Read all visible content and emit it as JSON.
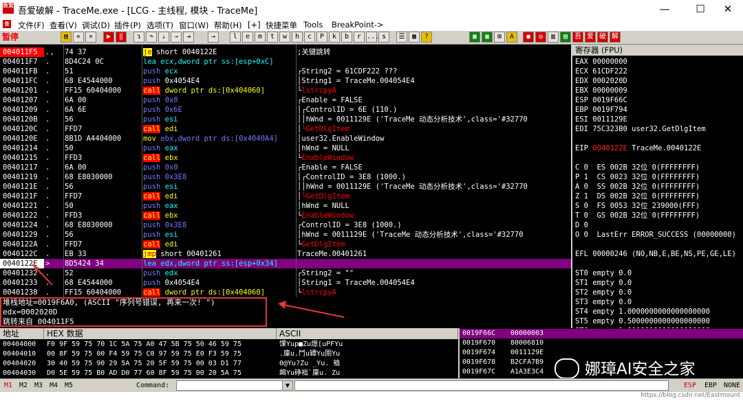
{
  "window": {
    "logo_text": "吾爱破解",
    "title": "吾爱破解 - TraceMe.exe - [LCG - 主线程, 模块 - TraceMe]",
    "min": "—",
    "max": "☐",
    "close": "✕"
  },
  "menu": [
    "文件(F)",
    "查看(V)",
    "调试(D)",
    "插件(P)",
    "选项(T)",
    "窗口(W)",
    "帮助(H)",
    "[+]",
    "快捷菜单",
    "Tools",
    "BreakPoint->"
  ],
  "toolbar": {
    "status": "暂停",
    "letters": [
      "l",
      "e",
      "m",
      "t",
      "w",
      "h",
      "c",
      "P",
      "k",
      "b",
      "r",
      "...",
      "s"
    ],
    "right_icons": [
      "吾",
      "爱",
      "破",
      "解"
    ]
  },
  "cpu": {
    "rows": [
      {
        "addr": "004011F5",
        "mark": "., ",
        "hex": "74 37",
        "mn": "je",
        "mncls": "op-jcc",
        "opd": "short 0040122E",
        "opdcls": "opd-w",
        "cmt": ";关键跳转",
        "cmtcls": "",
        "brk": "",
        "addrcls": "hl"
      },
      {
        "addr": "004011F7",
        "mark": ". ",
        "hex": "8D4C24 0C",
        "mn": "lea",
        "mncls": "op-lea",
        "opd": "ecx,dword ptr ss:[esp+0xC]",
        "opdcls": "opd-c",
        "cmt": "",
        "cmtcls": "",
        "brk": "",
        "addrcls": ""
      },
      {
        "addr": "004011FB",
        "mark": ". ",
        "hex": "51",
        "mn": "push",
        "mncls": "op-push",
        "opd": "ecx",
        "opdcls": "opd-c",
        "cmt": "String2 = 61CDF222 ???",
        "cmtcls": "",
        "brk": "┌",
        "addrcls": ""
      },
      {
        "addr": "004011FC",
        "mark": ". ",
        "hex": "68 E4544000",
        "mn": "push",
        "mncls": "op-push",
        "opd": "0x4054E4",
        "opdcls": "opd-w",
        "cmt": "String1 = TraceMe.004054E4",
        "cmtcls": "",
        "brk": "│",
        "addrcls": ""
      },
      {
        "addr": "00401201",
        "mark": ". ",
        "hex": "FF15 60404000",
        "mn": "call",
        "mncls": "op-call",
        "opd": "dword ptr ds:[0x404060]",
        "opdcls": "opd-y",
        "cmt": "lstrcpyA",
        "cmtcls": "cmt-red",
        "brk": "└",
        "addrcls": ""
      },
      {
        "addr": "00401207",
        "mark": ". ",
        "hex": "6A 00",
        "mn": "push",
        "mncls": "op-push",
        "opd": "0x0",
        "opdcls": "opd-b",
        "cmt": "Enable = FALSE",
        "cmtcls": "",
        "brk": "┌",
        "addrcls": ""
      },
      {
        "addr": "00401209",
        "mark": ". ",
        "hex": "6A 6E",
        "mn": "push",
        "mncls": "op-push",
        "opd": "0x6E",
        "opdcls": "opd-b",
        "cmt": "┌ControlID = 6E (110.)",
        "cmtcls": "",
        "brk": "│",
        "addrcls": ""
      },
      {
        "addr": "0040120B",
        "mark": ". ",
        "hex": "56",
        "mn": "push",
        "mncls": "op-push",
        "opd": "esi",
        "opdcls": "opd-c",
        "cmt": "│hWnd = 0011129E ('TraceMe 动态分析技术',class='#32770",
        "cmtcls": "",
        "brk": "│",
        "addrcls": ""
      },
      {
        "addr": "0040120C",
        "mark": ". ",
        "hex": "FFD7",
        "mn": "call",
        "mncls": "op-call",
        "opd": "edi",
        "opdcls": "opd-y",
        "cmt": "└GetDlgItem",
        "cmtcls": "cmt-red",
        "brk": "│",
        "addrcls": ""
      },
      {
        "addr": "0040120E",
        "mark": ". ",
        "hex": "8B1D A4404000",
        "mn": "mov",
        "mncls": "op-mov",
        "opd": "ebx,dword ptr ds:[0x4040A4]",
        "opdcls": "opd-b",
        "cmt": "user32.EnableWindow",
        "cmtcls": "",
        "brk": "│",
        "addrcls": ""
      },
      {
        "addr": "00401214",
        "mark": ". ",
        "hex": "50",
        "mn": "push",
        "mncls": "op-push",
        "opd": "eax",
        "opdcls": "opd-c",
        "cmt": "hWnd = NULL",
        "cmtcls": "",
        "brk": "│",
        "addrcls": ""
      },
      {
        "addr": "00401215",
        "mark": ". ",
        "hex": "FFD3",
        "mn": "call",
        "mncls": "op-call",
        "opd": "ebx",
        "opdcls": "opd-y",
        "cmt": "EnableWindow",
        "cmtcls": "cmt-red",
        "brk": "└",
        "addrcls": ""
      },
      {
        "addr": "00401217",
        "mark": ". ",
        "hex": "6A 00",
        "mn": "push",
        "mncls": "op-push",
        "opd": "0x0",
        "opdcls": "opd-b",
        "cmt": "Enable = FALSE",
        "cmtcls": "",
        "brk": "┌",
        "addrcls": ""
      },
      {
        "addr": "00401219",
        "mark": ". ",
        "hex": "68 E8030000",
        "mn": "push",
        "mncls": "op-push",
        "opd": "0x3E8",
        "opdcls": "opd-b",
        "cmt": "┌ControlID = 3E8 (1000.)",
        "cmtcls": "",
        "brk": "│",
        "addrcls": ""
      },
      {
        "addr": "0040121E",
        "mark": ". ",
        "hex": "56",
        "mn": "push",
        "mncls": "op-push",
        "opd": "esi",
        "opdcls": "opd-c",
        "cmt": "│hWnd = 0011129E ('TraceMe 动态分析技术',class='#32770",
        "cmtcls": "",
        "brk": "│",
        "addrcls": ""
      },
      {
        "addr": "0040121F",
        "mark": ". ",
        "hex": "FFD7",
        "mn": "call",
        "mncls": "op-call",
        "opd": "edi",
        "opdcls": "opd-y",
        "cmt": "└GetDlgItem",
        "cmtcls": "cmt-red",
        "brk": "│",
        "addrcls": ""
      },
      {
        "addr": "00401221",
        "mark": ". ",
        "hex": "50",
        "mn": "push",
        "mncls": "op-push",
        "opd": "eax",
        "opdcls": "opd-c",
        "cmt": "hWnd = NULL",
        "cmtcls": "",
        "brk": "│",
        "addrcls": ""
      },
      {
        "addr": "00401222",
        "mark": ". ",
        "hex": "FFD3",
        "mn": "call",
        "mncls": "op-call",
        "opd": "ebx",
        "opdcls": "opd-y",
        "cmt": "EnableWindow",
        "cmtcls": "cmt-red",
        "brk": "└",
        "addrcls": ""
      },
      {
        "addr": "00401224",
        "mark": ". ",
        "hex": "68 E8030000",
        "mn": "push",
        "mncls": "op-push",
        "opd": "0x3E8",
        "opdcls": "opd-b",
        "cmt": "ControlID = 3E8 (1000.)",
        "cmtcls": "",
        "brk": "┌",
        "addrcls": ""
      },
      {
        "addr": "00401229",
        "mark": ". ",
        "hex": "56",
        "mn": "push",
        "mncls": "op-push",
        "opd": "esi",
        "opdcls": "opd-c",
        "cmt": "hWnd = 0011129E ('TraceMe 动态分析技术',class='#32770",
        "cmtcls": "",
        "brk": "│",
        "addrcls": ""
      },
      {
        "addr": "0040122A",
        "mark": ". ",
        "hex": "FFD7",
        "mn": "call",
        "mncls": "op-call",
        "opd": "edi",
        "opdcls": "opd-y",
        "cmt": "GetDlgItem",
        "cmtcls": "cmt-red",
        "brk": "└",
        "addrcls": ""
      },
      {
        "addr": "0040122C",
        "mark": ". ",
        "hex": "EB 33",
        "mn": "jmp",
        "mncls": "op-jcc",
        "opd": "short 00401261",
        "opdcls": "opd-w",
        "cmt": "TraceMe.00401261",
        "cmtcls": "",
        "brk": "",
        "addrcls": ""
      },
      {
        "addr": "0040122E",
        "mark": "> ",
        "hex": "8D5424 34",
        "mn": "lea",
        "mncls": "op-lea",
        "opd": "edx,dword ptr ss:[esp+0x34]",
        "opdcls": "opd-c",
        "cmt": "",
        "cmtcls": "",
        "brk": "",
        "addrcls": "cur",
        "sel": true
      },
      {
        "addr": "00401232",
        "mark": ". ",
        "hex": "52",
        "mn": "push",
        "mncls": "op-push",
        "opd": "edx",
        "opdcls": "opd-c",
        "cmt": "String2 = \"\"",
        "cmtcls": "",
        "brk": "┌",
        "addrcls": ""
      },
      {
        "addr": "00401233",
        "mark": ". ",
        "hex": "68 E4544000",
        "mn": "push",
        "mncls": "op-push",
        "opd": "0x4054E4",
        "opdcls": "opd-w",
        "cmt": "String1 = TraceMe.004054E4",
        "cmtcls": "",
        "brk": "│",
        "addrcls": ""
      },
      {
        "addr": "00401238",
        "mark": ". ",
        "hex": "FF15 60404000",
        "mn": "call",
        "mncls": "op-call",
        "opd": "dword ptr ds:[0x404060]",
        "opdcls": "opd-y",
        "cmt": "lstrcpyA",
        "cmtcls": "cmt-red",
        "brk": "└",
        "addrcls": ""
      }
    ]
  },
  "info": {
    "line1": "堆栈地址=0019F6A0, (ASCII \"序列号错误, 再来一次! \")",
    "line2": "edx=0002020D",
    "line3": "跳转来自 004011F5"
  },
  "registers": {
    "header": "寄存器 (FPU)",
    "lines": [
      {
        "text": "EAX 00000000",
        "red": false
      },
      {
        "text": "ECX 61CDF222",
        "red": false
      },
      {
        "text": "EDX 0002020D",
        "red": false
      },
      {
        "text": "EBX 00000009",
        "red": false
      },
      {
        "text": "ESP 0019F66C",
        "red": false
      },
      {
        "text": "EBP 0019F794",
        "red": false
      },
      {
        "text": "ESI 0011129E",
        "red": false
      },
      {
        "text": "EDI 75C323B0 user32.GetDlgItem",
        "red": false
      },
      {
        "text": "",
        "red": false
      },
      {
        "text": "EIP ",
        "red": false,
        "eip_val": "0040122E",
        "eip_rest": " TraceMe.0040122E"
      },
      {
        "text": "",
        "red": false
      },
      {
        "text": "C 0  ES 002B 32位 0(FFFFFFFF)",
        "red": false
      },
      {
        "text": "P 1  CS 0023 32位 0(FFFFFFFF)",
        "red": false
      },
      {
        "text": "A 0  SS 002B 32位 0(FFFFFFFF)",
        "red": false
      },
      {
        "text": "Z 1  DS 002B 32位 0(FFFFFFFF)",
        "red": false
      },
      {
        "text": "S 0  FS 0053 32位 239000(FFF)",
        "red": false
      },
      {
        "text": "T 0  GS 002B 32位 0(FFFFFFFF)",
        "red": false
      },
      {
        "text": "D 0",
        "red": false
      },
      {
        "text": "O 0  LastErr ERROR_SUCCESS (00000000)",
        "red": false
      },
      {
        "text": "",
        "red": false
      },
      {
        "text": "EFL 00000246 (NO,NB,E,BE,NS,PE,GE,LE)",
        "red": false
      },
      {
        "text": "",
        "red": false
      },
      {
        "text": "ST0 empty 0.0",
        "red": false
      },
      {
        "text": "ST1 empty 0.0",
        "red": false
      },
      {
        "text": "ST2 empty 0.0",
        "red": false
      },
      {
        "text": "ST3 empty 0.0",
        "red": false
      },
      {
        "text": "ST4 empty 1.0000000000000000000",
        "red": false
      },
      {
        "text": "ST5 empty 0.5000000000000000000",
        "red": false
      },
      {
        "text": "ST6 empty 1.0000000000000000000",
        "red": false
      },
      {
        "text": "ST7 empty 1.0000000000000000000",
        "red": false
      }
    ]
  },
  "dump": {
    "headers": [
      "地址",
      "HEX 数据",
      "ASCII"
    ],
    "rows": [
      {
        "addr": "00404000",
        "hex": "F0 9F 59 75 70 1C 5A 75 A0 47 5B 75 50 46 59 75",
        "ascii": "馃Yup■Zu燝[uPFYu"
      },
      {
        "addr": "00404010",
        "hex": "00 8F 59 75 00 F4 59 75 C0 97 59 75 E0 F3 59 75",
        "ascii": ".廩u.鬥u罈Yu圉Yu"
      },
      {
        "addr": "00404020",
        "hex": "30 40 59 75 90 29 5A 75 20 5F 59 75 00 03 D1 77",
        "ascii": "0@Yu?Zu _Yu. 裇"
      },
      {
        "addr": "00404030",
        "hex": "D0 5E 59 75 B0 AD D0 77 60 8F 59 75 00 20 5A 75",
        "ascii": "衈Yu碀袦`廩u. Zu"
      }
    ]
  },
  "stack": {
    "rows": [
      {
        "addr": "0019F66C",
        "val": "00000003",
        "sel": true
      },
      {
        "addr": "0019F670",
        "val": "80006810",
        "sel": false
      },
      {
        "addr": "0019F674",
        "val": "0011129E",
        "sel": false
      },
      {
        "addr": "0019F678",
        "val": "B2CFA7B9",
        "sel": false
      },
      {
        "addr": "0019F67C",
        "val": "A1A3E3C4",
        "sel": false
      }
    ]
  },
  "watermark": "娜璋AI安全之家",
  "status": {
    "tabs": [
      "M1",
      "M2",
      "M3",
      "M4",
      "M5"
    ],
    "command_label": "Command:",
    "right": [
      "ESP",
      "EBP",
      "NONE"
    ],
    "url": "https://blog.csdn.net/Eastmount"
  },
  "colors": {
    "accent_red": "#e53935",
    "selection_purple": "#800080"
  }
}
